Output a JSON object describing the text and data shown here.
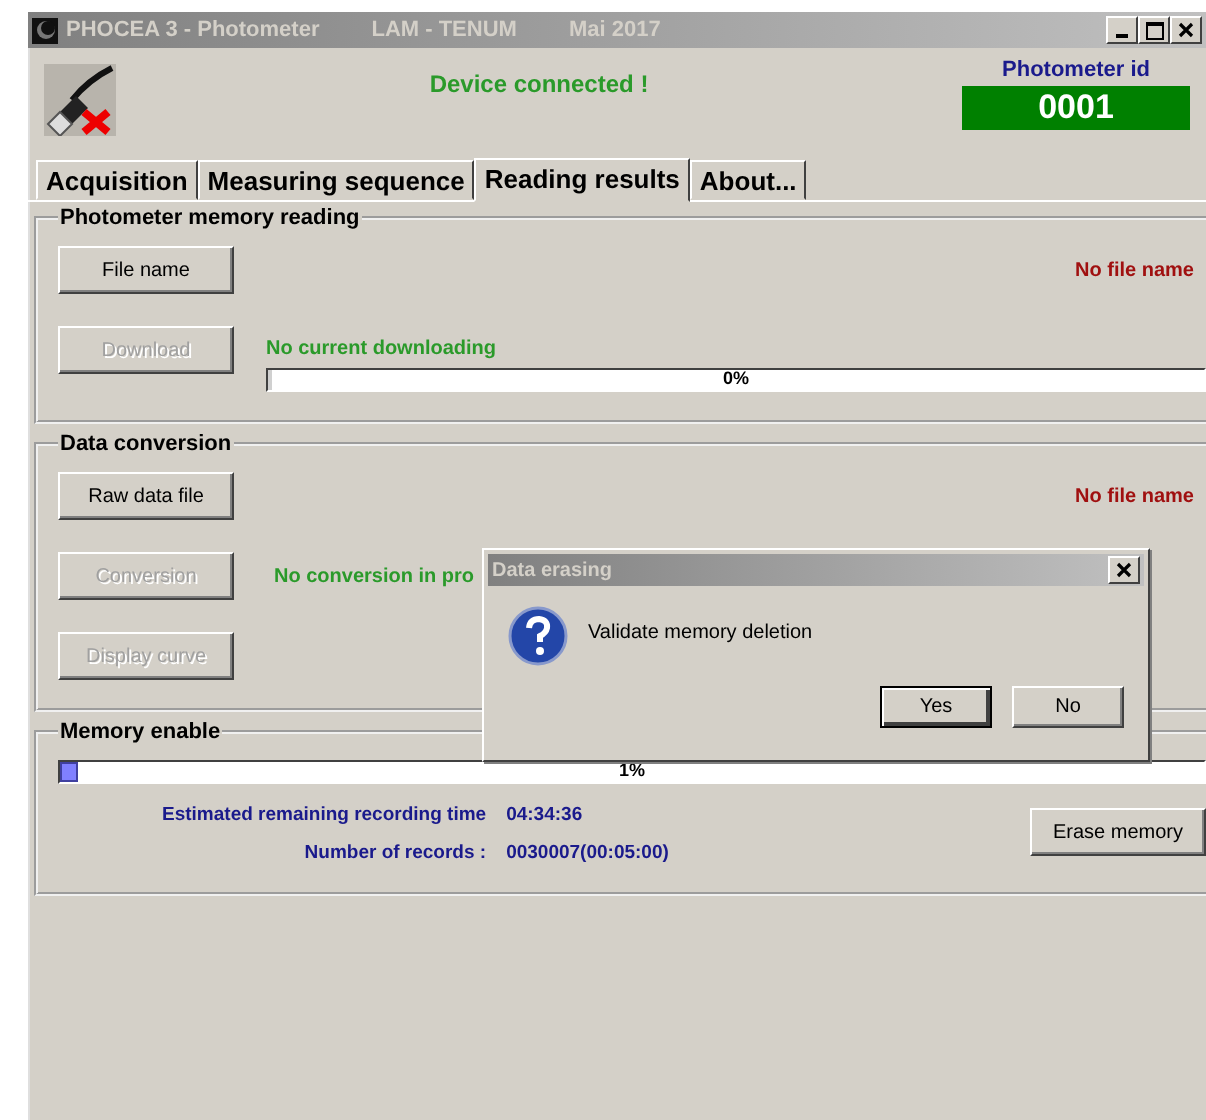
{
  "window": {
    "title": "PHOCEA 3 - Photometer",
    "lab": "LAM - TENUM",
    "date": "Mai 2017"
  },
  "status": "Device connected !",
  "photometer_id": {
    "label": "Photometer id",
    "value": "0001"
  },
  "tabs": [
    {
      "label": "Acquisition",
      "selected": false
    },
    {
      "label": "Measuring sequence",
      "selected": false
    },
    {
      "label": "Reading results",
      "selected": true
    },
    {
      "label": "About...",
      "selected": false
    }
  ],
  "memory_reading": {
    "title": "Photometer memory reading",
    "file_button": {
      "label": "File name",
      "disabled": false
    },
    "file_status": "No file name",
    "download_button": {
      "label": "Download",
      "disabled": true
    },
    "download_status": "No current downloading",
    "progress": {
      "level": 0,
      "text": "0%"
    }
  },
  "data_conversion": {
    "title": "Data conversion",
    "raw_button": {
      "label": "Raw data file",
      "disabled": false
    },
    "file_status": "No file name",
    "conversion_button": {
      "label": "Conversion",
      "disabled": true
    },
    "conversion_status": "No conversion in pro",
    "curve_button": {
      "label": "Display curve",
      "disabled": true
    }
  },
  "memory_enable": {
    "title": "Memory enable",
    "progress": {
      "level": 0.01,
      "text": "1%"
    },
    "remaining_label": "Estimated remaining recording time",
    "remaining_value": "04:34:36",
    "records_label": "Number of records :",
    "records_value": "0030007(00:05:00)",
    "erase_button": {
      "label": "Erase memory",
      "disabled": false
    }
  },
  "dialog": {
    "title": "Data erasing",
    "message": "Validate memory deletion",
    "buttons": [
      {
        "label": "Yes",
        "default": true
      },
      {
        "label": "No",
        "default": false
      }
    ]
  }
}
